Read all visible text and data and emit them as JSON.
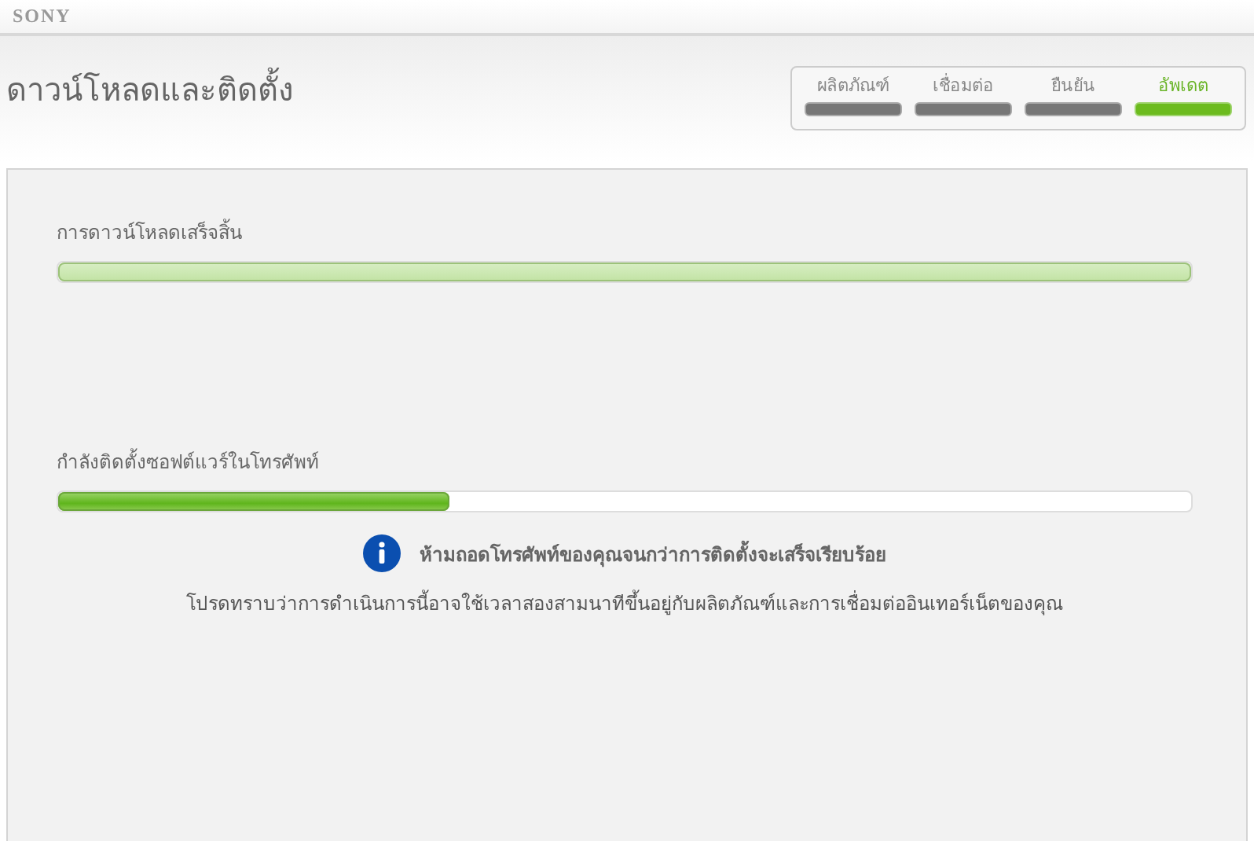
{
  "brand": "SONY",
  "title": "ดาวน์โหลดและติดตั้ง",
  "steps": [
    {
      "label": "ผลิตภัณฑ์",
      "selected": false
    },
    {
      "label": "เชื่อมต่อ",
      "selected": false
    },
    {
      "label": "ยืนยัน",
      "selected": false
    },
    {
      "label": "อัพเดต",
      "selected": true
    }
  ],
  "tasks": [
    {
      "label": "การดาวน์โหลดเสร็จสิ้น",
      "kind": "done",
      "level": 1
    },
    {
      "label": "กำลังติดตั้งซอฟต์แวร์ในโทรศัพท์",
      "kind": "active",
      "level": 0.345
    }
  ],
  "notice": {
    "heading": "ห้ามถอดโทรศัพท์ของคุณจนกว่าการติดตั้งจะเสร็จเรียบร้อย",
    "text": "โปรดทราบว่าการดำเนินการนี้อาจใช้เวลาสองสามนาทีขึ้นอยู่กับผลิตภัณฑ์และการเชื่อมต่ออินเทอร์เน็ตของคุณ"
  }
}
